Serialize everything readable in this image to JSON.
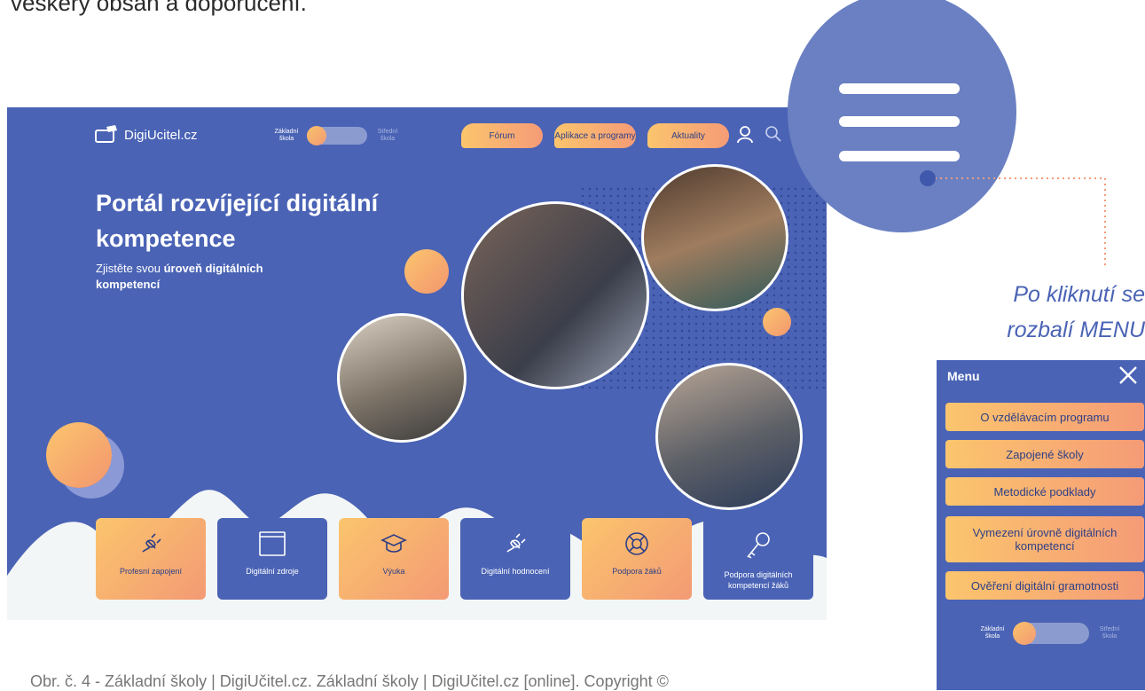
{
  "top_text": "veškerý obsah a doporučení.",
  "caption": "Obr. č. 4 - Základní školy | DigiUčitel.cz. Základní školy | DigiUčitel.cz [online]. Copyright ©",
  "site": {
    "logo_text": "DigiUcitel.cz",
    "toggle": {
      "left": "Základní škola",
      "right": "Střední škola"
    },
    "nav": {
      "forum": "Fórum",
      "apps": "Aplikace a programy",
      "news": "Aktuality"
    },
    "hero": {
      "title": "Portál rozvíjející digitální kompetence",
      "sub_prefix": "Zjistěte svou ",
      "sub_bold": "úroveň digitálních kompetencí"
    },
    "cards": [
      {
        "label": "Profesní zapojení",
        "icon": "plug-icon"
      },
      {
        "label": "Digitální zdroje",
        "icon": "window-icon"
      },
      {
        "label": "Výuka",
        "icon": "graduation-cap-icon"
      },
      {
        "label": "Digitální hodnocení",
        "icon": "plug-icon"
      },
      {
        "label": "Podpora žáků",
        "icon": "lifebuoy-icon"
      },
      {
        "label": "Podpora digitálních kompetencí žáků",
        "icon": "key-icon"
      }
    ]
  },
  "annotation": {
    "line1": "Po kliknutí se",
    "line2": "rozbalí MENU"
  },
  "menu": {
    "title": "Menu",
    "items": [
      "O vzdělávacím programu",
      "Zapojené školy",
      "Metodické podklady",
      "Vymezení úrovně digitálních kompetencí",
      "Ověření digitální gramotnosti"
    ],
    "toggle": {
      "left": "Základní škola",
      "right": "Střední škola"
    }
  },
  "colors": {
    "brand_blue": "#4a63b5",
    "accent_orange": "#f59b77",
    "accent_yellow": "#fbc56d"
  }
}
